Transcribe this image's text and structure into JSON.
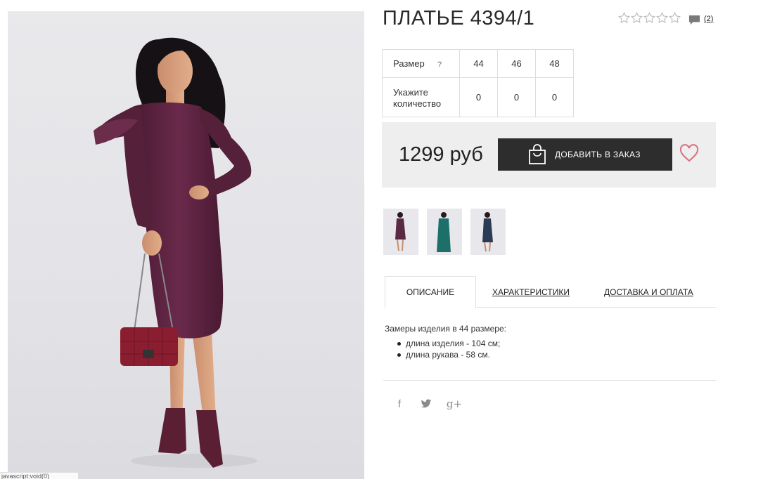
{
  "product": {
    "title": "ПЛАТЬЕ 4394/1",
    "rating": {
      "value": 0,
      "max": 5
    },
    "comments_count": "(2)"
  },
  "sizes": {
    "size_label": "Размер",
    "help_mark": "?",
    "qty_label": "Укажите количество",
    "columns": [
      {
        "size": "44",
        "quantity": "0"
      },
      {
        "size": "46",
        "quantity": "0"
      },
      {
        "size": "48",
        "quantity": "0"
      }
    ]
  },
  "purchase": {
    "price": "1299 руб",
    "add_button_label": "ДОБАВИТЬ В ЗАКАЗ"
  },
  "thumbnails": [
    {
      "icon": "dress-thumbnail",
      "dress_color": "#5a2a45"
    },
    {
      "icon": "dress-thumbnail",
      "dress_color": "#1d6f6a"
    },
    {
      "icon": "dress-thumbnail",
      "dress_color": "#2c3b55"
    }
  ],
  "tabs": {
    "description": "ОПИСАНИЕ",
    "characteristics": "ХАРАКТЕРИСТИКИ",
    "delivery": "ДОСТАВКА И ОПЛАТА",
    "active": "description"
  },
  "description": {
    "intro": "Замеры изделия в 44 размере:",
    "items": [
      "длина изделия - 104 см;",
      "длина рукава - 58 см."
    ]
  },
  "social": {
    "facebook": "f",
    "google_plus": "g+",
    "icons": [
      "facebook-icon",
      "twitter-icon",
      "google-plus-icon"
    ]
  },
  "status_bar": {
    "text": "javascript:void(0)"
  },
  "colors": {
    "dress": "#5b2240",
    "button": "#2d2d2d",
    "heart": "#d9707f",
    "panel": "#eeeeee"
  }
}
